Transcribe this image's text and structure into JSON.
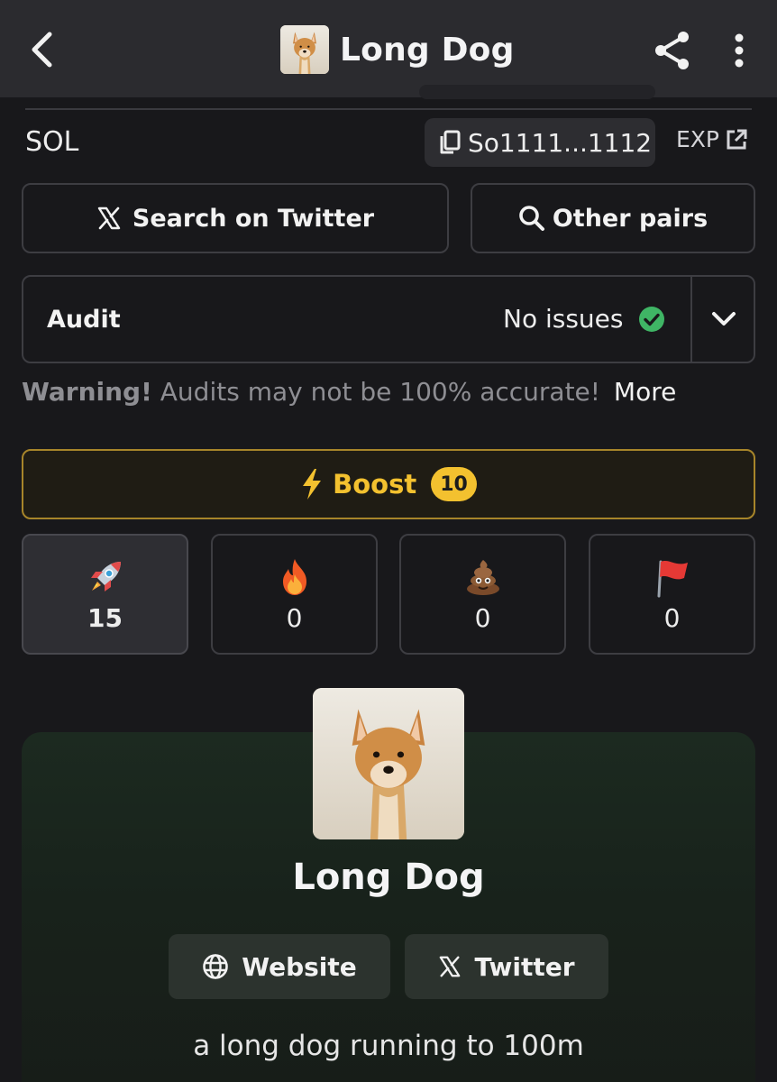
{
  "header": {
    "title": "Long Dog",
    "back_icon": "chevron-left-icon",
    "share_icon": "share-icon",
    "more_icon": "more-vertical-icon"
  },
  "chain": {
    "name": "SOL",
    "address": "So1111...1112",
    "copy_icon": "copy-icon",
    "explorer_label": "EXP",
    "explorer_icon": "external-link-icon"
  },
  "actions": {
    "search_twitter_label": "Search on Twitter",
    "other_pairs_label": "Other pairs"
  },
  "audit": {
    "label": "Audit",
    "status": "No issues",
    "status_color": "#3fb565"
  },
  "warning": {
    "bold": "Warning!",
    "text": "Audits may not be 100% accurate!",
    "more": "More"
  },
  "boost": {
    "label": "Boost",
    "count": "10",
    "accent": "#f3c12f"
  },
  "reactions": [
    {
      "icon": "rocket-icon",
      "count": "15"
    },
    {
      "icon": "fire-icon",
      "count": "0"
    },
    {
      "icon": "poop-icon",
      "count": "0"
    },
    {
      "icon": "red-flag-icon",
      "count": "0"
    }
  ],
  "token": {
    "name": "Long Dog",
    "website_label": "Website",
    "twitter_label": "Twitter",
    "description": "a long dog running to 100m"
  }
}
